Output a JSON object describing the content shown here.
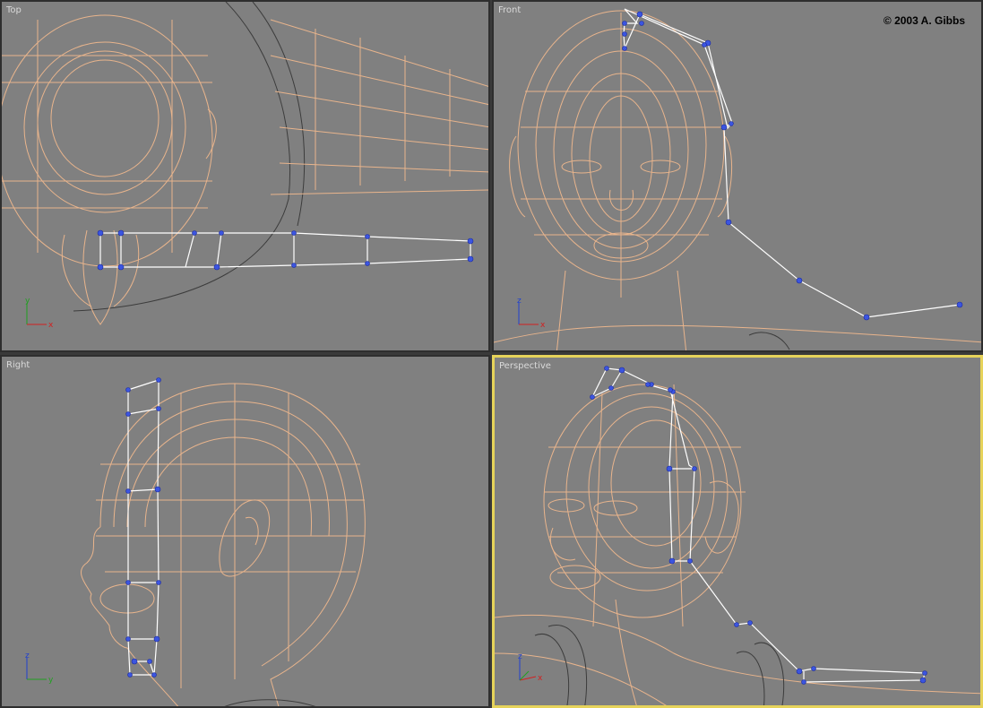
{
  "viewports": {
    "top": {
      "label": "Top"
    },
    "front": {
      "label": "Front",
      "copyright": "© 2003 A. Gibbs"
    },
    "right": {
      "label": "Right"
    },
    "perspective": {
      "label": "Perspective",
      "active": true
    }
  },
  "axes": {
    "top": {
      "v": "y",
      "h": "x"
    },
    "front": {
      "v": "z",
      "h": "x"
    },
    "right": {
      "v": "z",
      "h": "y"
    },
    "perspective": {
      "v": "z",
      "h": "x"
    }
  },
  "colors": {
    "viewport_bg": "#808080",
    "mesh": "#e8b48c",
    "mesh_dark": "#3c3c3c",
    "bone": "#ffffff",
    "bone_node": "#3b55e0",
    "active_border": "#e6d35a",
    "axis_x": "#d22020",
    "axis_y": "#20a020",
    "axis_z": "#2040d0"
  }
}
